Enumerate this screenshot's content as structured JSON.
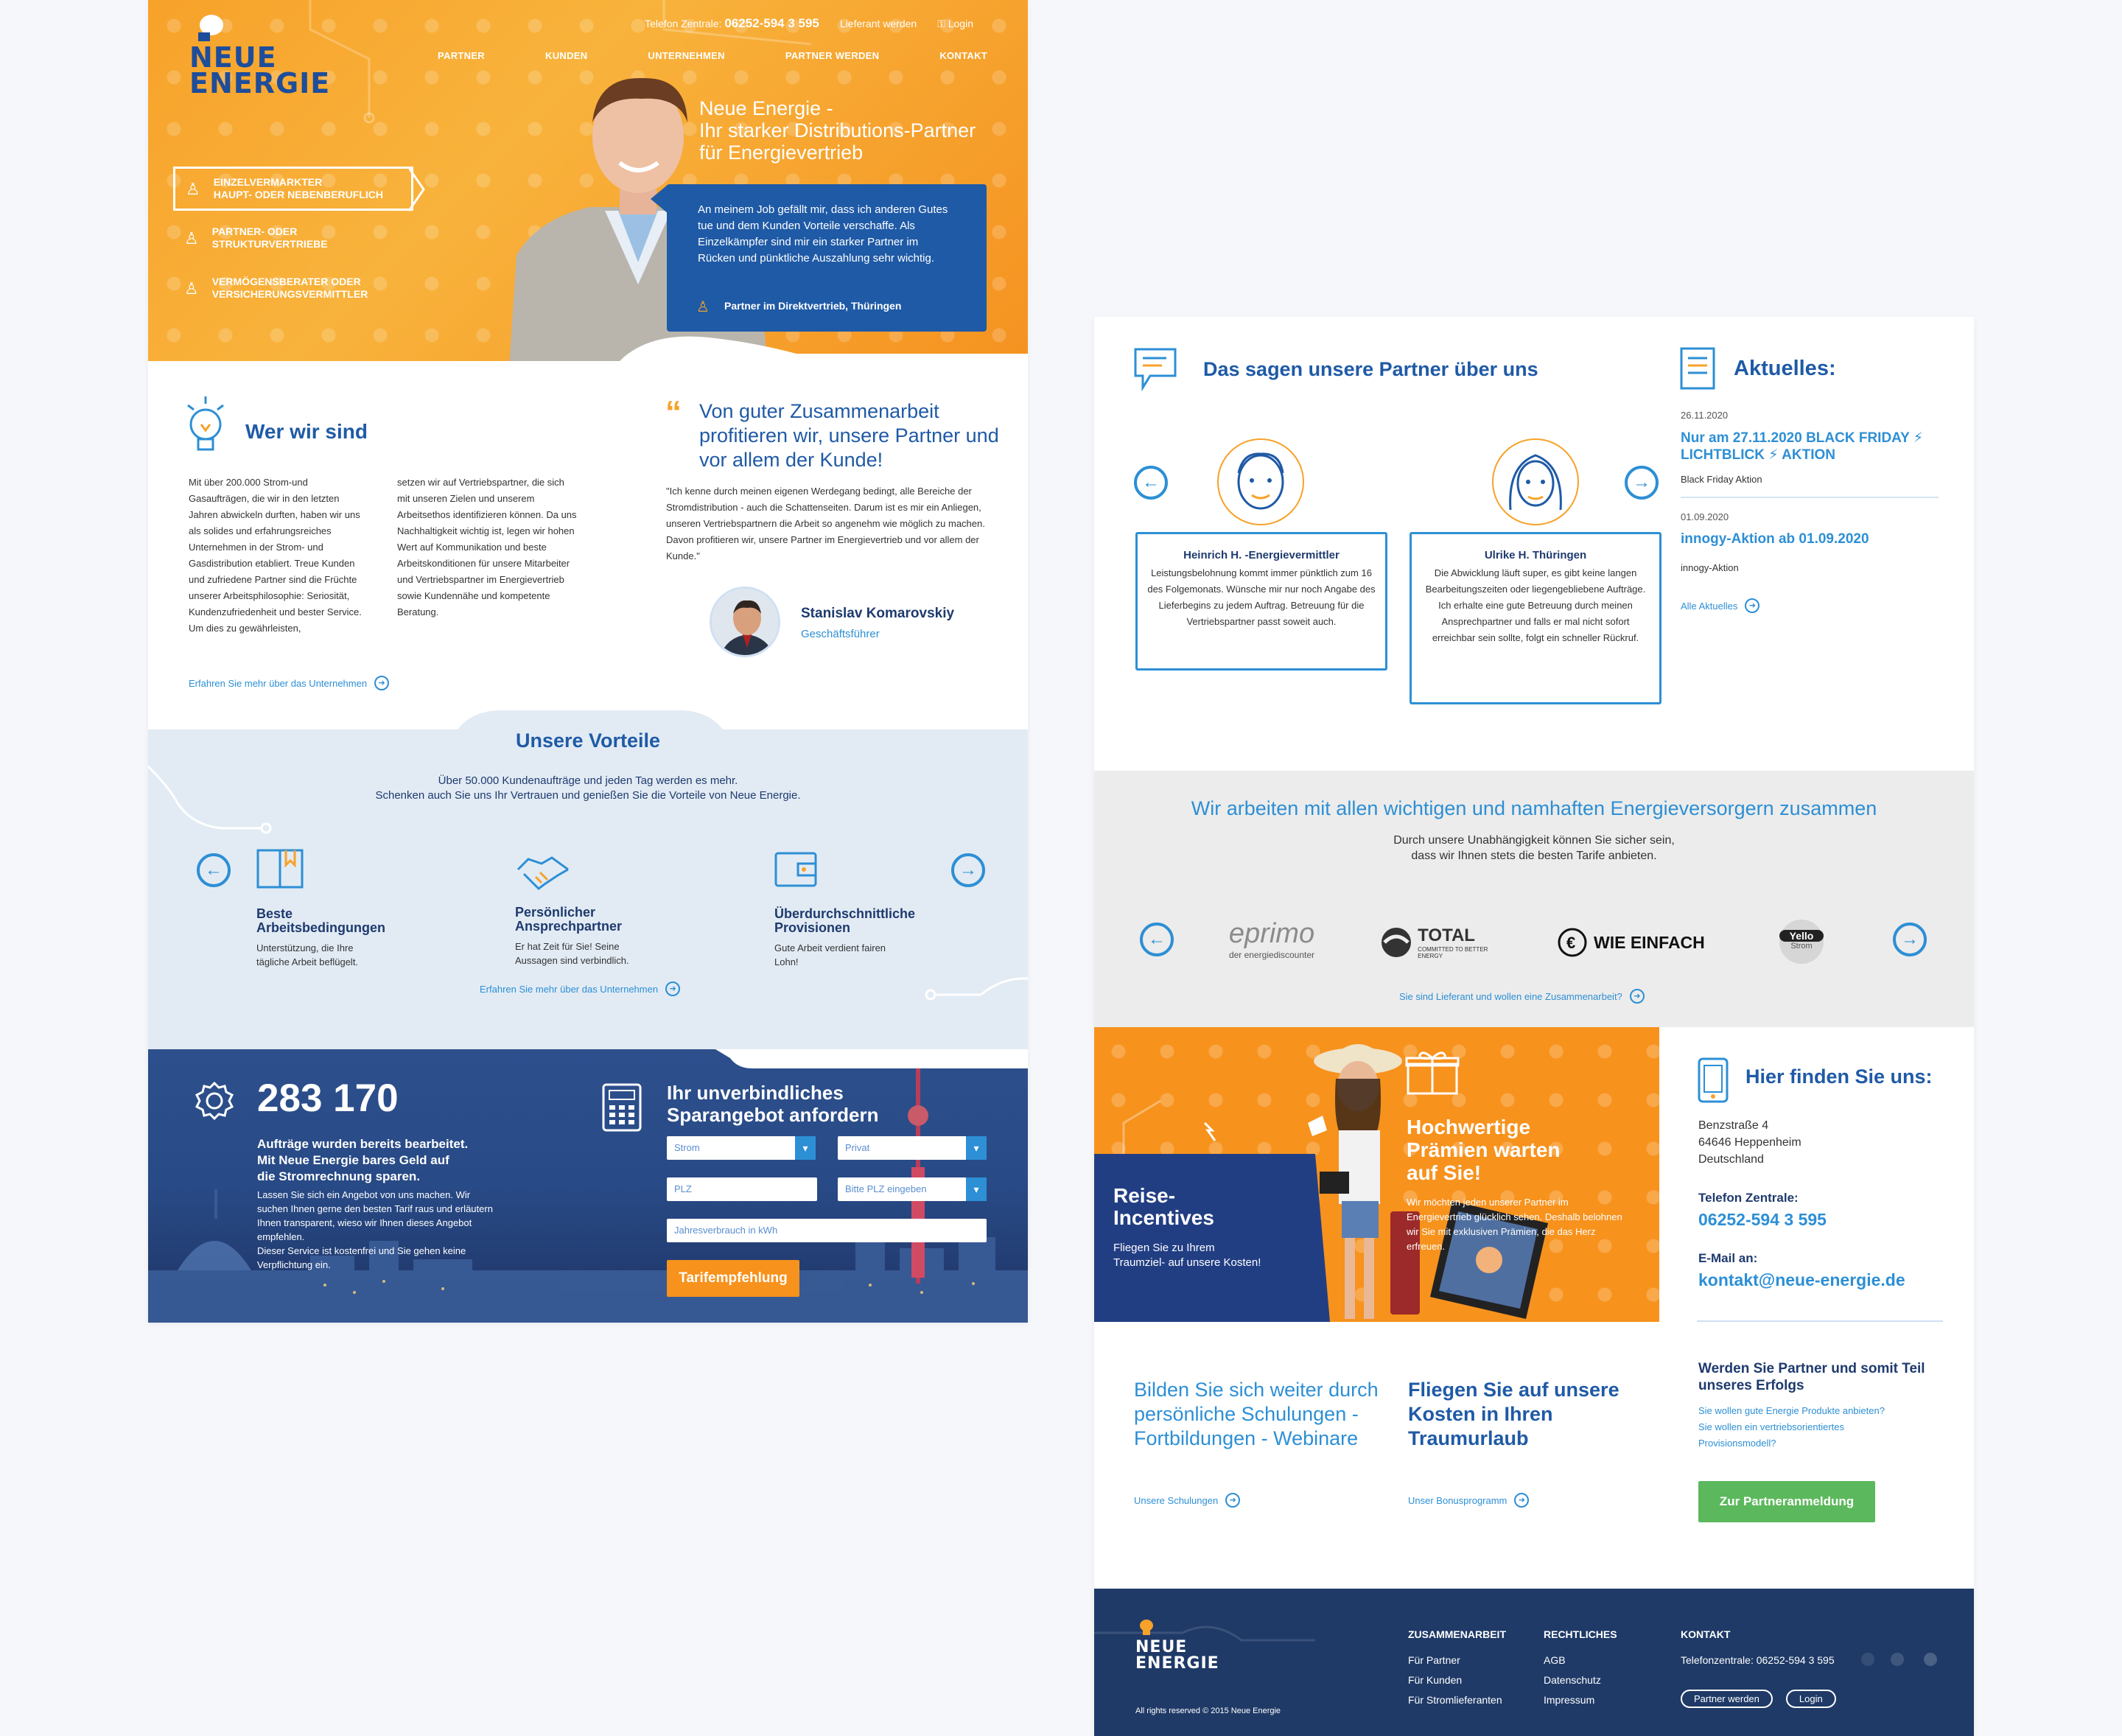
{
  "header": {
    "phone_label": "Telefon Zentrale:",
    "phone": "06252-594 3 595",
    "supplier": "Lieferant werden",
    "login": "Login",
    "logo_line1": "NEUE",
    "logo_line2": "ENERGIE",
    "nav": [
      "PARTNER",
      "KUNDEN",
      "UNTERNEHMEN",
      "PARTNER WERDEN",
      "KONTAKT"
    ]
  },
  "hero": {
    "title": "Neue Energie -\nIhr starker Distributions-Partner\nfür Energievertrieb",
    "segments": [
      "EINZELVERMARKTER\nHAUPT- ODER NEBENBERUFLICH",
      "PARTNER- ODER\nSTRUKTURVERTRIEBE",
      "VERMÖGENSBERATER ODER\nVERSICHERUNGSVERMITTLER"
    ],
    "quote": "An meinem Job gefällt mir, dass ich anderen Gutes tue und dem Kunden Vorteile verschaffe. Als Einzelkämpfer sind mir ein starker Partner im Rücken und pünktliche Auszahlung sehr wichtig.",
    "quote_author": "Partner im Direktvertrieb, Thüringen"
  },
  "about": {
    "title": "Wer wir sind",
    "col1": "Mit über 200.000 Strom-und Gasaufträgen, die wir in den letzten Jahren abwickeln durften, haben wir uns als solides und erfahrungsreiches Unternehmen in der Strom- und Gasdistribution etabliert. Treue Kunden und zufriedene Partner sind die Früchte unserer Arbeitsphilosophie: Seriosität, Kundenzufriedenheit und bester Service. Um dies zu gewährleisten,",
    "col2": "setzen wir auf Vertriebspartner, die sich mit unseren Zielen und unserem Arbeitsethos identifizieren können. Da uns Nachhaltigkeit wichtig ist, legen wir hohen Wert auf Kommunikation und beste Arbeitskonditionen für unsere Mitarbeiter und Vertriebspartner im Energievertrieb sowie Kundennähe und kompetente Beratung.",
    "link": "Erfahren Sie mehr über das Unternehmen",
    "quote_title": "Von guter Zusammenarbeit profitieren wir, unsere Partner und vor allem der Kunde!",
    "quote_text": "\"Ich kenne durch meinen eigenen Werdegang bedingt, alle Bereiche der Stromdistribution - auch die Schattenseiten. Darum ist es mir ein Anliegen, unseren Vertriebspartnern die Arbeit so angenehm wie möglich zu machen. Davon profitieren wir, unsere Partner im Energievertrieb und vor allem der Kunde.\"",
    "ceo_name": "Stanislav Komarovskiy",
    "ceo_role": "Geschäftsführer"
  },
  "vorteile": {
    "title": "Unsere Vorteile",
    "subtitle1": "Über 50.000 Kundenaufträge und jeden Tag werden es mehr.",
    "subtitle2": "Schenken auch Sie uns Ihr Vertrauen und genießen Sie die Vorteile von Neue Energie.",
    "items": [
      {
        "title": "Beste\nArbeitsbedingungen",
        "text": "Unterstützung, die Ihre\ntägliche Arbeit beflügelt."
      },
      {
        "title": "Persönlicher\nAnsprechpartner",
        "text": "Er hat Zeit für Sie! Seine\nAussagen sind verbindlich."
      },
      {
        "title": "Überdurchschnittliche\nProvisionen",
        "text": "Gute Arbeit verdient fairen\nLohn!"
      }
    ],
    "link": "Erfahren Sie mehr über das Unternehmen"
  },
  "counter": {
    "number": "283 170",
    "headline": "Aufträge wurden bereits bearbeitet.\nMit Neue Energie bares Geld auf\ndie Stromrechnung sparen.",
    "text": "Lassen Sie sich ein Angebot von uns machen. Wir suchen Ihnen gerne den besten Tarif raus und erläutern Ihnen transparent, wieso wir Ihnen dieses Angebot empfehlen.\nDieser Service ist kostenfrei und Sie gehen keine Verpflichtung ein.",
    "form_title": "Ihr unverbindliches\nSparangebot anfordern",
    "field_type": "Strom",
    "field_customer": "Privat",
    "field_plz": "PLZ",
    "field_plz2": "Bitte PLZ eingeben",
    "field_usage": "Jahresverbrauch in kWh",
    "submit": "Tarifempfehlung"
  },
  "testimonials": {
    "title": "Das sagen unsere Partner über uns",
    "items": [
      {
        "name": "Heinrich H. -Energievermittler",
        "text": "Leistungsbelohnung kommt immer pünktlich zum 16 des Folgemonats. Wünsche mir nur noch Angabe des Lieferbegins zu jedem Auftrag. Betreuung für die Vertriebspartner passt soweit auch."
      },
      {
        "name": "Ulrike H. Thüringen",
        "text": "Die Abwicklung läuft super, es gibt keine langen Bearbeitungszeiten oder liegengebliebene Aufträge. Ich erhalte eine gute Betreuung durch meinen Ansprechpartner und falls er mal nicht sofort erreichbar sein sollte, folgt ein schneller Rückruf."
      }
    ]
  },
  "news": {
    "title": "Aktuelles:",
    "items": [
      {
        "date": "26.11.2020",
        "title": "Nur am 27.11.2020 BLACK FRIDAY ⚡ LICHTBLICK ⚡ AKTION",
        "sub": "Black Friday Aktion"
      },
      {
        "date": "01.09.2020",
        "title": "innogy-Aktion ab 01.09.2020",
        "sub": "innogy-Aktion"
      }
    ],
    "all": "Alle Aktuelles"
  },
  "partners": {
    "title": "Wir arbeiten mit allen wichtigen und namhaften Energieversorgern zusammen",
    "sub1": "Durch unsere Unabhängigkeit können Sie sicher sein,",
    "sub2": "dass wir Ihnen stets die besten Tarife anbieten.",
    "logos": [
      {
        "name": "eprimo",
        "sub": "der energiediscounter"
      },
      {
        "name": "TOTAL",
        "sub": "COMMITTED TO BETTER ENERGY"
      },
      {
        "name": "WIE EINFACH",
        "sub": ""
      },
      {
        "name": "Yello",
        "sub": "Strom"
      }
    ],
    "link": "Sie sind Lieferant und wollen eine Zusammenarbeit?"
  },
  "promo": {
    "reise_title": "Reise-\nIncentives",
    "reise_text": "Fliegen Sie zu Ihrem\nTraumziel- auf unsere Kosten!",
    "praemien_title": "Hochwertige\nPrämien warten\nauf Sie!",
    "praemien_text": "Wir möchten jeden unserer Partner im Energievertrieb glücklich sehen. Deshalb belohnen wir Sie mit exklusiven Prämien, die das Herz erfreuen.",
    "schulung_title": "Bilden Sie sich weiter durch persönliche Schulungen - Fortbildungen - Webinare",
    "schulung_link": "Unsere Schulungen",
    "urlaub_title": "Fliegen Sie auf unsere Kosten in Ihren Traumurlaub",
    "urlaub_link": "Unser Bonusprogramm"
  },
  "contact": {
    "title": "Hier finden Sie uns:",
    "address": [
      "Benzstraße 4",
      "64646 Heppenheim",
      "Deutschland"
    ],
    "phone_label": "Telefon Zentrale:",
    "phone": "06252-594 3 595",
    "email_label": "E-Mail an:",
    "email": "kontakt@neue-energie.de",
    "cta_title": "Werden Sie Partner und somit Teil unseres Erfolgs",
    "cta_lines": [
      "Sie wollen gute Energie Produkte anbieten?",
      "Sie wollen ein vertriebsorientiertes",
      "Provisionsmodell?"
    ],
    "cta_button": "Zur Partneranmeldung"
  },
  "footer": {
    "copyright": "All rights reserved © 2015 Neue Energie",
    "col1_title": "ZUSAMMENARBEIT",
    "col1": [
      "Für Partner",
      "Für Kunden",
      "Für Stromlieferanten"
    ],
    "col2_title": "RECHTLICHES",
    "col2": [
      "AGB",
      "Datenschutz",
      "Impressum"
    ],
    "col3_title": "KONTAKT",
    "col3_phone": "Telefonzentrale: 06252-594 3 595",
    "btn_partner": "Partner werden",
    "btn_login": "Login"
  },
  "colors": {
    "primary": "#1f5aa6",
    "accent_blue": "#2d8fd5",
    "orange": "#f7a22a",
    "green": "#5cb85c",
    "navy": "#1f3a67"
  }
}
